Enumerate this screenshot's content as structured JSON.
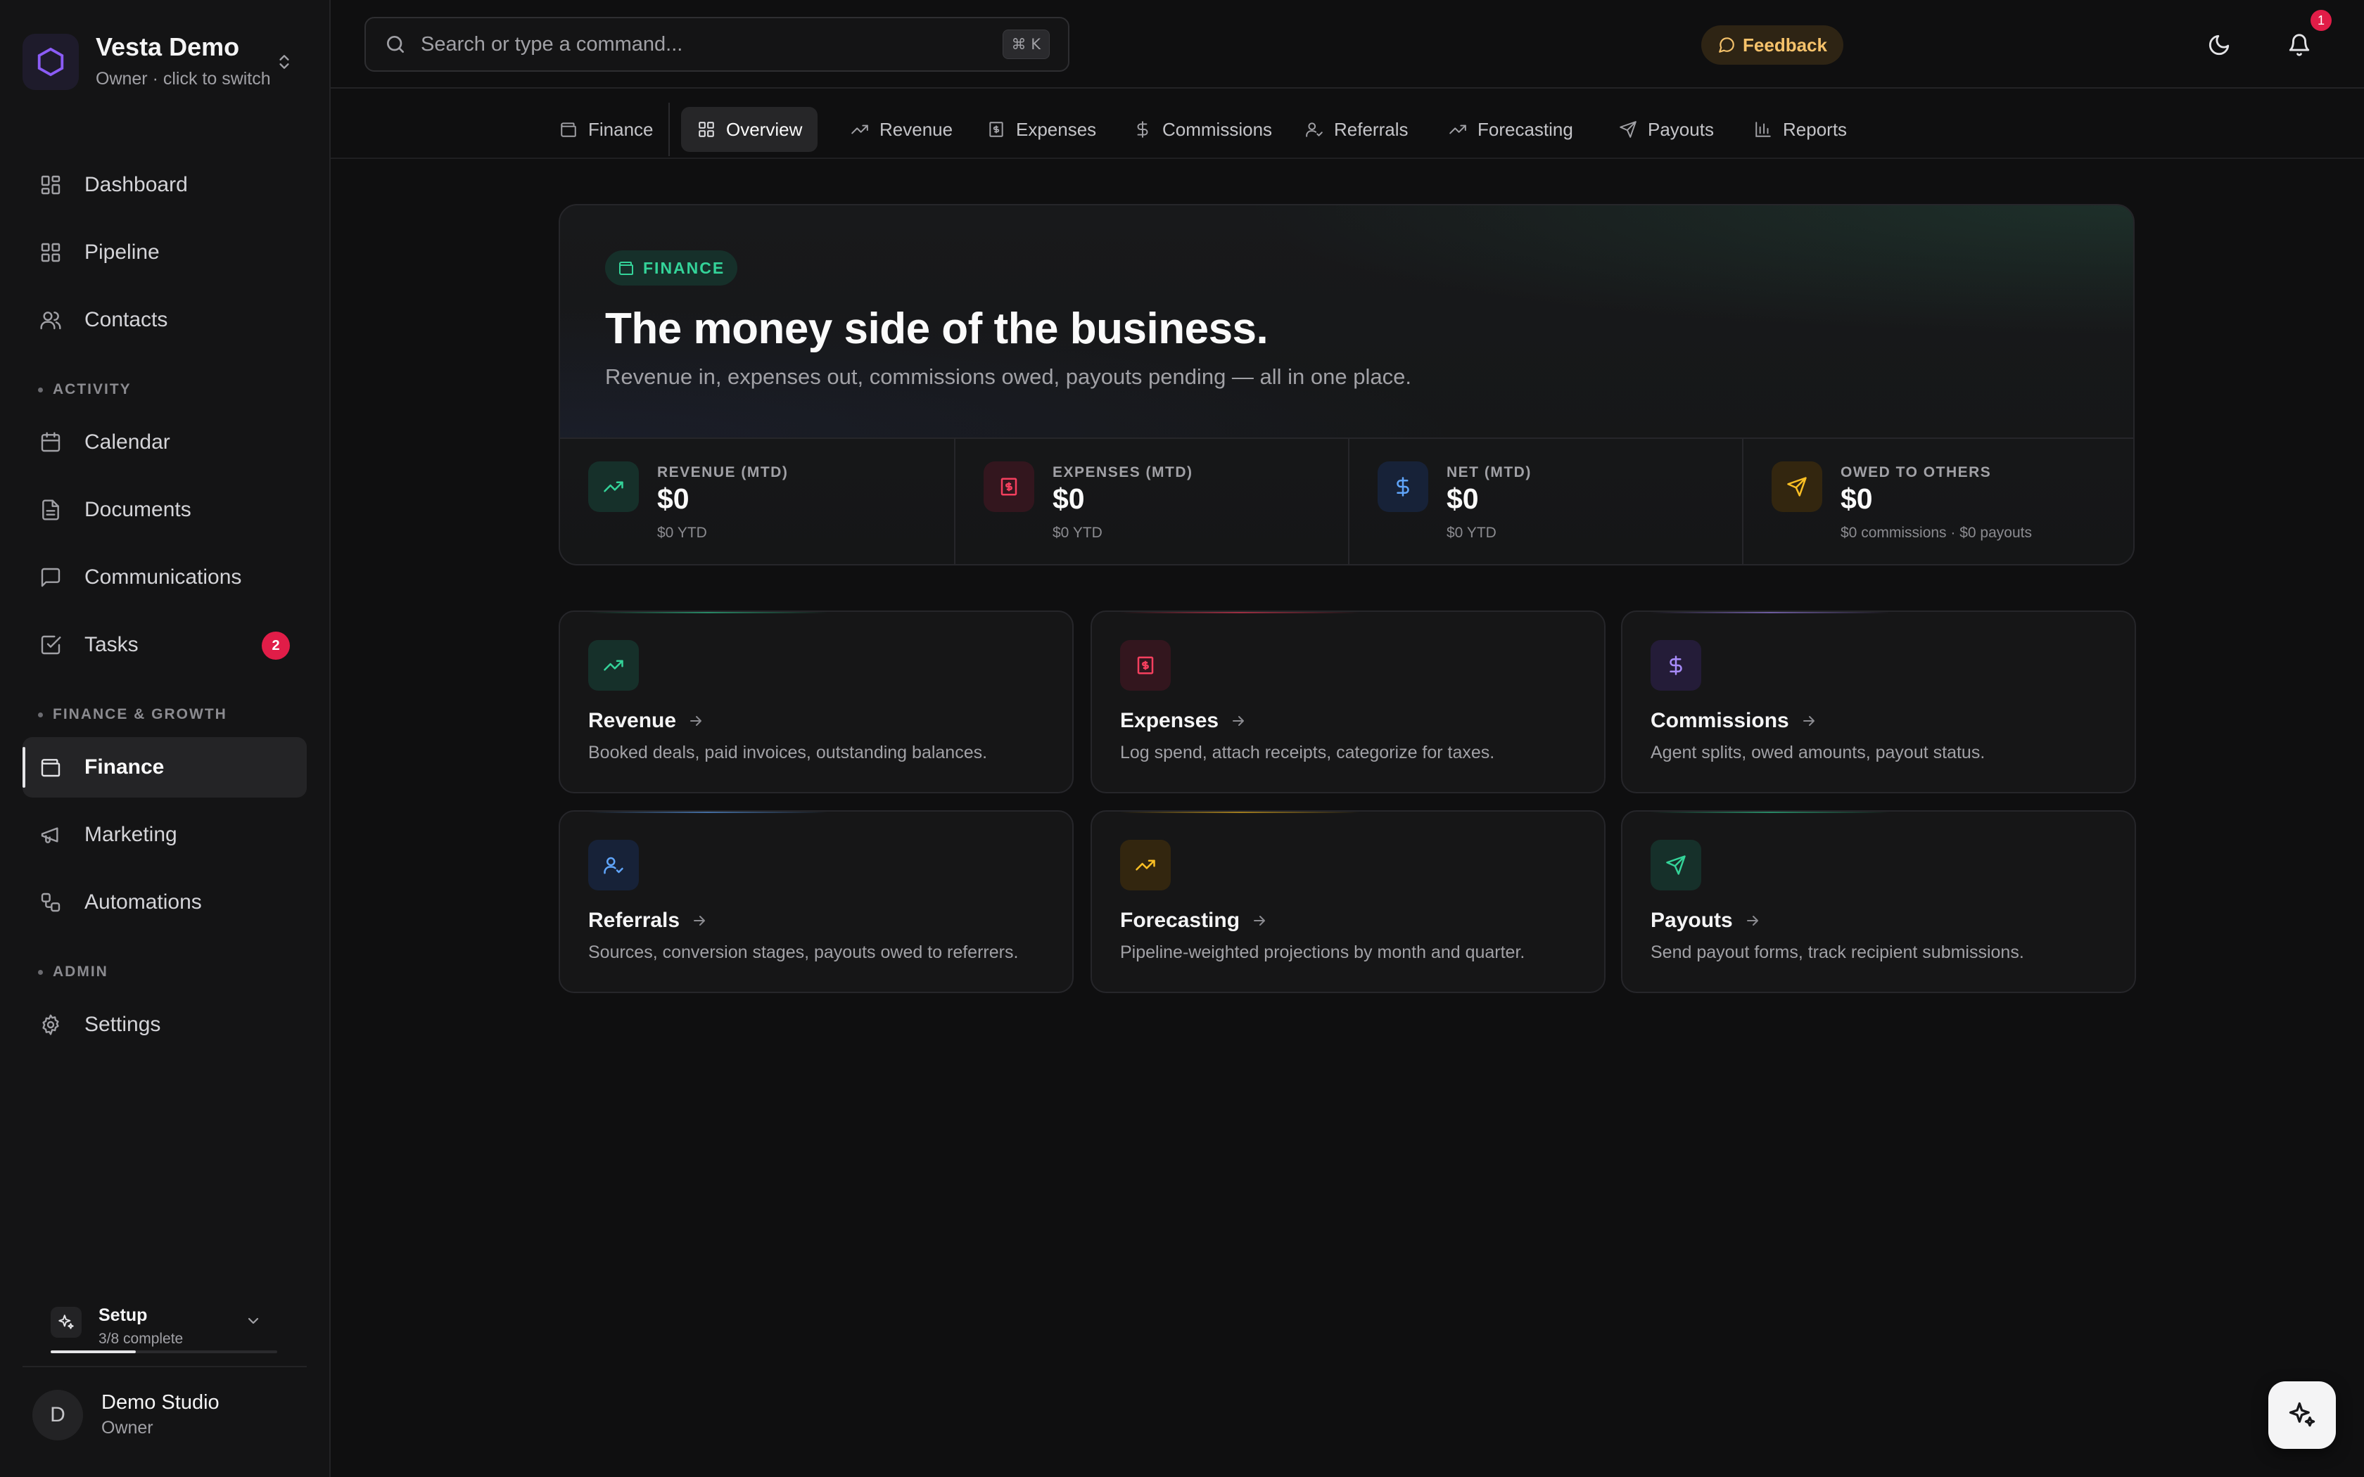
{
  "workspace": {
    "name": "Vesta Demo",
    "subtitle": "Owner · click to switch"
  },
  "sidebar": {
    "items": [
      {
        "label": "Dashboard",
        "icon": "grid-icon"
      },
      {
        "label": "Pipeline",
        "icon": "grid-icon"
      },
      {
        "label": "Contacts",
        "icon": "users-icon"
      },
      {
        "label": "Calendar",
        "icon": "calendar-icon"
      },
      {
        "label": "Documents",
        "icon": "file-icon"
      },
      {
        "label": "Communications",
        "icon": "message-icon"
      },
      {
        "label": "Tasks",
        "icon": "checkbox-icon",
        "badge": "2"
      },
      {
        "label": "Finance",
        "icon": "wallet-icon",
        "active": true
      },
      {
        "label": "Marketing",
        "icon": "megaphone-icon"
      },
      {
        "label": "Automations",
        "icon": "workflow-icon"
      },
      {
        "label": "Settings",
        "icon": "gear-icon"
      }
    ],
    "sections": {
      "activity": "ACTIVITY",
      "finance_growth": "FINANCE & GROWTH",
      "admin": "ADMIN"
    }
  },
  "setup": {
    "title": "Setup",
    "progress_text": "3/8 complete",
    "progress_fraction": 0.375
  },
  "user": {
    "initial": "D",
    "name": "Demo Studio",
    "role": "Owner"
  },
  "search": {
    "placeholder": "Search or type a command...",
    "shortcut": "⌘ K"
  },
  "header": {
    "feedback_label": "Feedback",
    "notification_count": "1"
  },
  "tabs": [
    {
      "label": "Finance",
      "icon": "wallet-icon"
    },
    {
      "label": "Overview",
      "icon": "grid-icon",
      "active": true
    },
    {
      "label": "Revenue",
      "icon": "trending-up-icon"
    },
    {
      "label": "Expenses",
      "icon": "receipt-icon"
    },
    {
      "label": "Commissions",
      "icon": "dollar-icon"
    },
    {
      "label": "Referrals",
      "icon": "user-check-icon"
    },
    {
      "label": "Forecasting",
      "icon": "trending-up-icon"
    },
    {
      "label": "Payouts",
      "icon": "send-icon"
    },
    {
      "label": "Reports",
      "icon": "bar-chart-icon"
    }
  ],
  "hero": {
    "pill": "FINANCE",
    "title": "The money side of the business.",
    "subtitle": "Revenue in, expenses out, commissions owed, payouts pending — all in one place."
  },
  "stats": [
    {
      "label": "REVENUE (MTD)",
      "value": "$0",
      "sub": "$0 YTD",
      "color": "#34d399"
    },
    {
      "label": "EXPENSES (MTD)",
      "value": "$0",
      "sub": "$0 YTD",
      "color": "#f43f5e"
    },
    {
      "label": "NET (MTD)",
      "value": "$0",
      "sub": "$0 YTD",
      "color": "#60a5fa"
    },
    {
      "label": "OWED TO OTHERS",
      "value": "$0",
      "sub": "$0 commissions · $0 payouts",
      "color": "#fbbf24"
    }
  ],
  "cards": [
    {
      "title": "Revenue",
      "desc": "Booked deals, paid invoices, outstanding balances.",
      "color": "#34d399"
    },
    {
      "title": "Expenses",
      "desc": "Log spend, attach receipts, categorize for taxes.",
      "color": "#f43f5e"
    },
    {
      "title": "Commissions",
      "desc": "Agent splits, owed amounts, payout status.",
      "color": "#a78bfa"
    },
    {
      "title": "Referrals",
      "desc": "Sources, conversion stages, payouts owed to referrers.",
      "color": "#60a5fa"
    },
    {
      "title": "Forecasting",
      "desc": "Pipeline-weighted projections by month and quarter.",
      "color": "#fbbf24"
    },
    {
      "title": "Payouts",
      "desc": "Send payout forms, track recipient submissions.",
      "color": "#34d399"
    }
  ]
}
